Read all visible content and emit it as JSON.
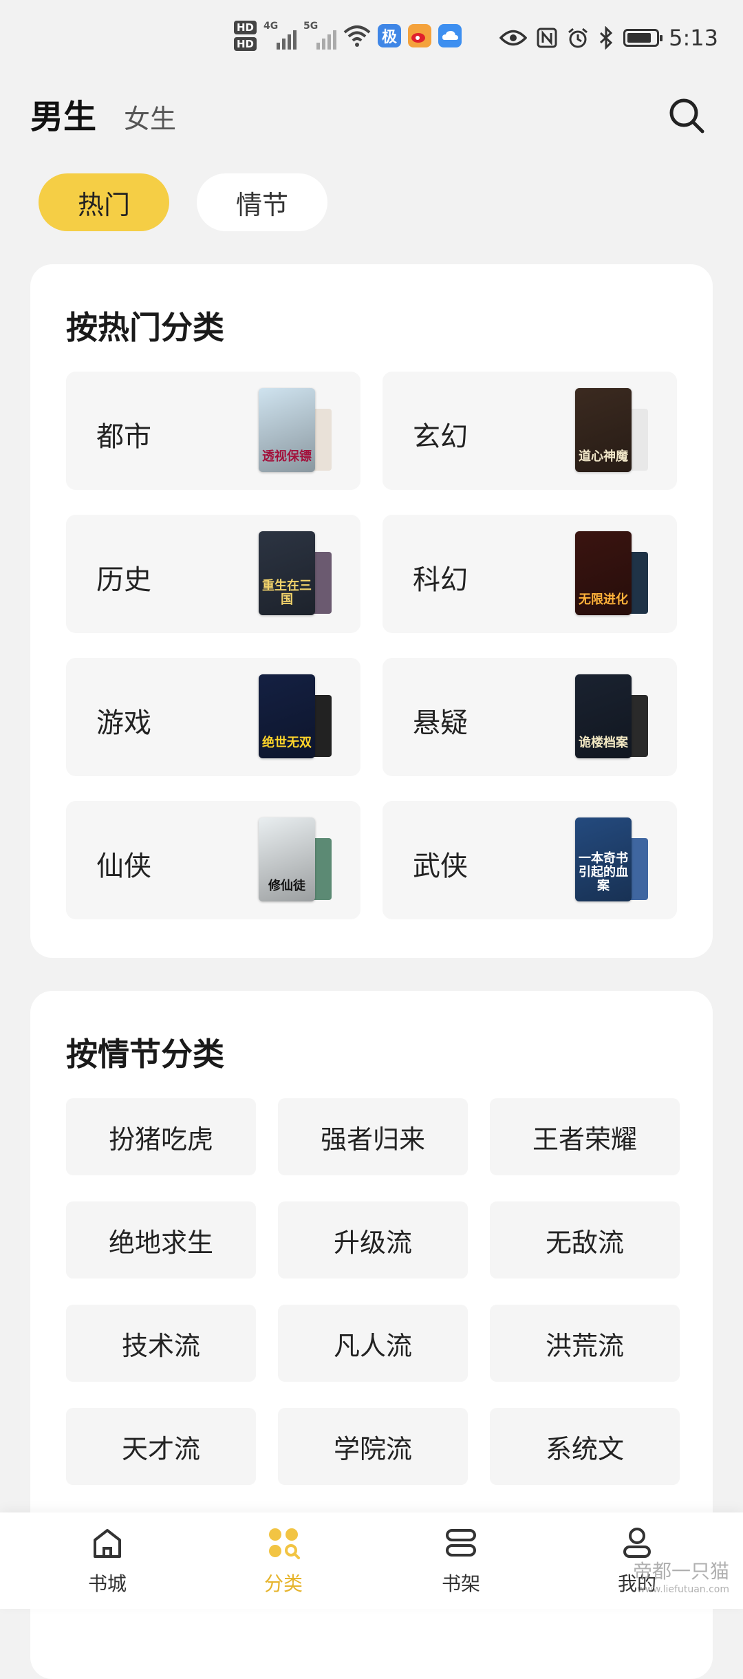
{
  "status_bar": {
    "hd1": "HD",
    "hd2": "HD",
    "net1": "4G",
    "net2": "5G",
    "app_badge": "极",
    "time": "5:13"
  },
  "header": {
    "tab_male": "男生",
    "tab_female": "女生"
  },
  "filter_tabs": [
    "热门",
    "情节"
  ],
  "hot_section": {
    "title": "按热门分类",
    "items": [
      {
        "label": "都市",
        "cover_title": "透视保镖",
        "cover_bg": "#cfe3ef",
        "cover_fg": "#a3123c",
        "back_bg": "#e9e1d8"
      },
      {
        "label": "玄幻",
        "cover_title": "道心神魔",
        "cover_bg": "#3b2a20",
        "cover_fg": "#f0e6c8",
        "back_bg": "#e8e8e8"
      },
      {
        "label": "历史",
        "cover_title": "重生在三国",
        "cover_bg": "#2c3442",
        "cover_fg": "#f2d36b",
        "back_bg": "#6b5a70"
      },
      {
        "label": "科幻",
        "cover_title": "无限进化",
        "cover_bg": "#3a1410",
        "cover_fg": "#ffb23a",
        "back_bg": "#1f3347"
      },
      {
        "label": "游戏",
        "cover_title": "绝世无双",
        "cover_bg": "#142042",
        "cover_fg": "#ffd42a",
        "back_bg": "#222222"
      },
      {
        "label": "悬疑",
        "cover_title": "诡楼档案",
        "cover_bg": "#1a2230",
        "cover_fg": "#f1e7c2",
        "back_bg": "#2a2a2a"
      },
      {
        "label": "仙侠",
        "cover_title": "修仙徒",
        "cover_bg": "#e9eef0",
        "cover_fg": "#111111",
        "back_bg": "#5c8a74"
      },
      {
        "label": "武侠",
        "cover_title": "一本奇书引起的血案",
        "cover_bg": "#244a7e",
        "cover_fg": "#ffffff",
        "back_bg": "#3f66a0"
      }
    ]
  },
  "plot_section": {
    "title": "按情节分类",
    "items": [
      "扮猪吃虎",
      "强者归来",
      "王者荣耀",
      "绝地求生",
      "升级流",
      "无敌流",
      "技术流",
      "凡人流",
      "洪荒流",
      "天才流",
      "学院流",
      "系统文"
    ]
  },
  "bottom_nav": {
    "items": [
      {
        "label": "书城",
        "icon": "home-icon"
      },
      {
        "label": "分类",
        "icon": "category-icon"
      },
      {
        "label": "书架",
        "icon": "bookshelf-icon"
      },
      {
        "label": "我的",
        "icon": "profile-icon"
      }
    ],
    "active_color": "#e6b42c"
  },
  "watermark": {
    "line1": "帝都一只猫",
    "line2": "www.liefutuan.com"
  },
  "colors": {
    "accent": "#f5ce45",
    "background": "#f2f2f2"
  }
}
